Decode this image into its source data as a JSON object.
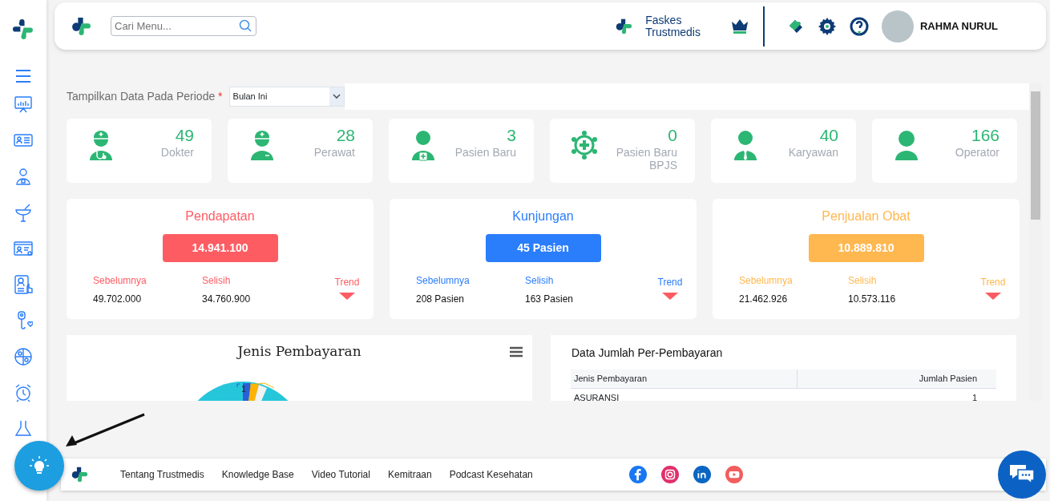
{
  "header": {
    "search": {
      "placeholder": "Cari Menu..."
    },
    "faskes": "Faskes\nTrustmedis",
    "user": "RAHMA NURUL"
  },
  "filter": {
    "label": "Tampilkan Data Pada Periode",
    "required": "*",
    "value": "Bulan Ini"
  },
  "stats": [
    {
      "value": "49",
      "label": "Dokter"
    },
    {
      "value": "28",
      "label": "Perawat"
    },
    {
      "value": "3",
      "label": "Pasien Baru"
    },
    {
      "value": "0",
      "label": "Pasien Baru BPJS"
    },
    {
      "value": "40",
      "label": "Karyawan"
    },
    {
      "value": "166",
      "label": "Operator"
    }
  ],
  "summaries": [
    {
      "title": "Pendapatan",
      "color": "#fd5c63",
      "value": "14.941.100",
      "prev_label": "Sebelumnya",
      "prev_value": "49.702.000",
      "diff_label": "Selisih",
      "diff_value": "34.760.900",
      "trend_label": "Trend",
      "trend_down": true
    },
    {
      "title": "Kunjungan",
      "color": "#2a7dfb",
      "value": "45 Pasien",
      "prev_label": "Sebelumnya",
      "prev_value": "208 Pasien",
      "diff_label": "Selisih",
      "diff_value": "163 Pasien",
      "trend_label": "Trend",
      "trend_down": true
    },
    {
      "title": "Penjualan Obat",
      "color": "#ffb74f",
      "value": "10.889.810",
      "prev_label": "Sebelumnya",
      "prev_value": "21.462.926",
      "diff_label": "Selisih",
      "diff_value": "10.573.116",
      "trend_label": "Trend",
      "trend_down": true
    }
  ],
  "payment_chart": {
    "title": "Jenis Pembayaran",
    "slice_label": "1"
  },
  "payment_table": {
    "title": "Data Jumlah Per-Pembayaran",
    "columns": [
      "Jenis Pembayaran",
      "Jumlah Pasien"
    ],
    "rows": [
      [
        "ASURANSI",
        "1"
      ]
    ]
  },
  "footer": {
    "links": [
      "Tentang Trustmedis",
      "Knowledge Base",
      "Video Tutorial",
      "Kemitraan",
      "Podcast Kesehatan"
    ]
  }
}
